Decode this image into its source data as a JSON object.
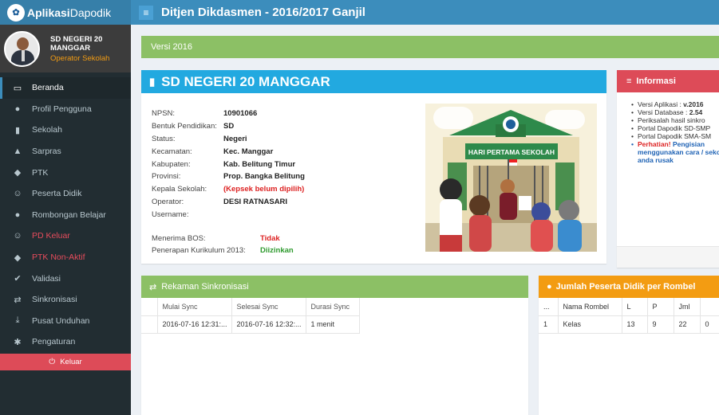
{
  "app": {
    "brand_bold": "Aplikasi",
    "brand_rest": "Dapodik",
    "header_title": "Ditjen Dikdasmen - 2016/2017 Ganjil"
  },
  "user": {
    "name": "SD NEGERI 20 MANGGAR",
    "role": "Operator Sekolah"
  },
  "menu": [
    {
      "label": "Beranda",
      "icon": "monitor-icon",
      "glyph": "▭"
    },
    {
      "label": "Profil Pengguna",
      "icon": "user-icon",
      "glyph": "●"
    },
    {
      "label": "Sekolah",
      "icon": "building-icon",
      "glyph": "▮"
    },
    {
      "label": "Sarpras",
      "icon": "road-icon",
      "glyph": "▲"
    },
    {
      "label": "PTK",
      "icon": "graduation-cap-icon",
      "glyph": "◆"
    },
    {
      "label": "Peserta Didik",
      "icon": "smile-icon",
      "glyph": "☺"
    },
    {
      "label": "Rombongan Belajar",
      "icon": "users-icon",
      "glyph": "●"
    },
    {
      "label": "PD Keluar",
      "icon": "smile-icon",
      "glyph": "☺"
    },
    {
      "label": "PTK Non-Aktif",
      "icon": "graduation-cap-icon",
      "glyph": "◆"
    },
    {
      "label": "Validasi",
      "icon": "check-icon",
      "glyph": "✔"
    },
    {
      "label": "Sinkronisasi",
      "icon": "exchange-icon",
      "glyph": "⇄"
    },
    {
      "label": "Pusat Unduhan",
      "icon": "download-icon",
      "glyph": "⤓"
    },
    {
      "label": "Pengaturan",
      "icon": "gear-icon",
      "glyph": "✱"
    }
  ],
  "logout_label": "Keluar",
  "version_label": "Versi 2016",
  "school": {
    "title": "SD NEGERI 20 MANGGAR",
    "fields": [
      {
        "label": "NPSN:",
        "value": "10901066"
      },
      {
        "label": "Bentuk Pendidikan:",
        "value": "SD"
      },
      {
        "label": "Status:",
        "value": "Negeri"
      },
      {
        "label": "Kecamatan:",
        "value": "Kec. Manggar"
      },
      {
        "label": "Kabupaten:",
        "value": "Kab. Belitung Timur"
      },
      {
        "label": "Provinsi:",
        "value": "Prop. Bangka Belitung"
      },
      {
        "label": "Kepala Sekolah:",
        "value": "(Kepsek belum dipilih)"
      },
      {
        "label": "Operator:",
        "value": "DESI RATNASARI"
      },
      {
        "label": "Username:",
        "value": ""
      }
    ],
    "bos_label": "Menerima BOS:",
    "bos_value": "Tidak",
    "kurikulum_label": "Penerapan Kurikulum 2013:",
    "kurikulum_value": "Diizinkan",
    "banner_text": "HARI PERTAMA SEKOLAH"
  },
  "info": {
    "title": "Informasi",
    "item1_label": "Versi Aplikasi : ",
    "item1_value": "v.2016",
    "item2_label": "Versi Database : ",
    "item2_value": "2.54",
    "item3": "Periksalah hasil sinkro",
    "item4": "Portal Dapodik SD-SMP",
    "item5": "Portal Dapodik SMA-SM",
    "warn_bold": "Perhatian!",
    "warn_text": " Pengisian menggunakan cara / sekolah anda rusak"
  },
  "sync": {
    "title": "Rekaman Sinkronisasi",
    "columns": [
      "Mulai Sync",
      "Selesai Sync",
      "Durasi Sync"
    ],
    "rows": [
      {
        "mulai": "2016-07-16 12:31:...",
        "selesai": "2016-07-16 12:32:...",
        "durasi": "1 menit"
      }
    ]
  },
  "rombel": {
    "title": "Jumlah Peserta Didik per Rombel",
    "columns": [
      "...",
      "Nama Rombel",
      "L",
      "P",
      "Jml",
      ""
    ],
    "rows": [
      {
        "no": "1",
        "nama": "Kelas",
        "l": "13",
        "p": "9",
        "jml": "22",
        "extra": "0"
      }
    ]
  },
  "colors": {
    "header": "#3c8dbc",
    "sidebar": "#222d32",
    "green": "#8cc065",
    "blue": "#22a9e0",
    "red": "#dd4b58",
    "orange": "#f39c12"
  }
}
